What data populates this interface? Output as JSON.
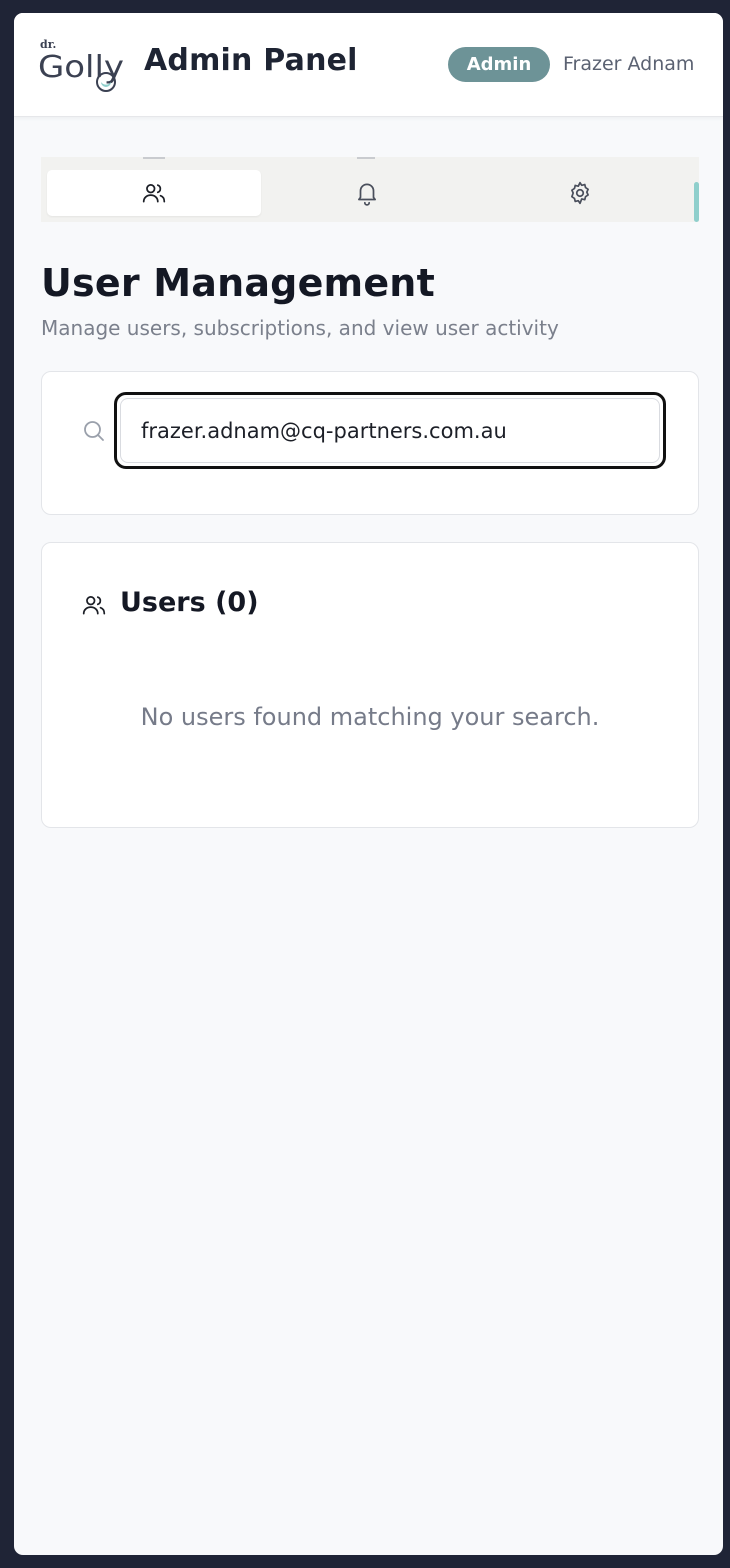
{
  "header": {
    "logo": {
      "top_text": "dr.",
      "word": "Golly"
    },
    "title": "Admin Panel",
    "role_badge": "Admin",
    "user_name": "Frazer Adnam"
  },
  "tabs": [
    {
      "icon": "users-icon",
      "active": true
    },
    {
      "icon": "bell-icon",
      "active": false
    },
    {
      "icon": "gear-icon",
      "active": false
    }
  ],
  "page": {
    "title": "User Management",
    "subtitle": "Manage users, subscriptions, and view user activity"
  },
  "search": {
    "value": "frazer.adnam@cq-partners.com.au",
    "icon": "search-icon"
  },
  "users": {
    "title": "Users (0)",
    "empty_message": "No users found matching your search."
  },
  "colors": {
    "accent": "#6d9397",
    "scroll_indicator": "#8fcfcc",
    "background": "#f8f9fb",
    "outer_frame": "#1f2436"
  }
}
